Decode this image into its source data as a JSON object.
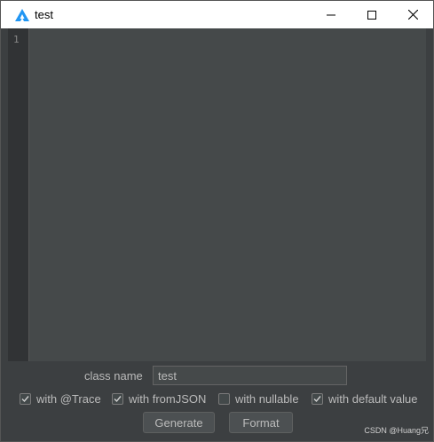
{
  "window": {
    "title": "test",
    "icon": "app-logo-icon",
    "controls": [
      "minimize-icon",
      "maximize-icon",
      "close-icon"
    ]
  },
  "editor": {
    "line_numbers": [
      "1"
    ],
    "content": ""
  },
  "form": {
    "class_name_label": "class name",
    "class_name_value": "test",
    "options": [
      {
        "label": "with @Trace",
        "checked": true
      },
      {
        "label": "with fromJSON",
        "checked": true
      },
      {
        "label": "with nullable",
        "checked": false
      },
      {
        "label": "with default value",
        "checked": true
      }
    ],
    "buttons": {
      "generate": "Generate",
      "format": "Format"
    }
  },
  "watermark": "CSDN @Huang兄",
  "colors": {
    "editor_bg": "#45494a",
    "panel_bg": "#3c3f41",
    "text": "#bbbbbb",
    "icon_blue": "#1e88e5"
  }
}
